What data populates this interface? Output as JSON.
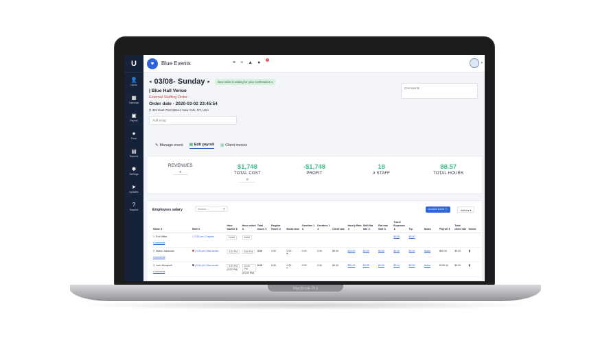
{
  "device": {
    "model_label": "MacBook Pro"
  },
  "sidebar": {
    "logo": "U",
    "items": [
      {
        "label": "Users",
        "icon": "user-icon",
        "glyph": "👤"
      },
      {
        "label": "Calendar",
        "icon": "calendar-icon",
        "glyph": "▦"
      },
      {
        "label": "Payroll",
        "icon": "payroll-icon",
        "glyph": "▣"
      },
      {
        "label": "Feed",
        "icon": "chat-icon",
        "glyph": "●"
      },
      {
        "label": "Reports",
        "icon": "report-icon",
        "glyph": "▤"
      },
      {
        "label": "Settings",
        "icon": "gear-icon",
        "glyph": "✱"
      },
      {
        "label": "Updates",
        "icon": "send-icon",
        "glyph": "➤"
      },
      {
        "label": "Support",
        "icon": "help-icon",
        "glyph": "?"
      }
    ]
  },
  "topbar": {
    "app_title": "Blue Events",
    "notification_count": "5"
  },
  "event": {
    "date_title": "03/08- Sunday",
    "status_pill": "New order is waiting for your confirmation",
    "venue": "| Blue Hall Venue",
    "order_type": "External Staffing Order -",
    "order_date": "Order date - 2020-03-02 23:45:54",
    "address": "321 East 73rd Street, New York, NY, USA",
    "tag_placeholder": "Add a tag",
    "comments_placeholder": "Comments"
  },
  "tabs": [
    {
      "label": "Manage event",
      "icon": "edit-icon"
    },
    {
      "label": "Edit payroll",
      "icon": "payroll-icon",
      "active": true
    },
    {
      "label": "Client invoice",
      "icon": "invoice-icon"
    }
  ],
  "stats": {
    "revenues_label": "REVENUES",
    "revenues_value": "0",
    "total_cost_value": "$1,748",
    "total_cost_label": "TOTAL COST",
    "total_cost_sub": "0",
    "profit_value": "-$1,748",
    "profit_label": "PROFIT",
    "staff_value": "18",
    "staff_label": "# STAFF",
    "hours_value": "88.57",
    "hours_label": "TOTAL HOURS",
    "accent_color": "#3bbf8a"
  },
  "salary": {
    "title": "Employees salary",
    "search_placeholder": "Search...",
    "archive_button": "Archive event",
    "actions_button": "Actions",
    "headers": [
      "Name ⇕",
      "Shift ⇕",
      "Hour started ⇕",
      "Hour ended ⇕",
      "Total hours ⇕",
      "Regular Hours ⇕",
      "Break time",
      "Overtime 1 ⇕",
      "Overtime 2 ⇕",
      "Client rate",
      "Hourly Rate ⇕",
      "Shift flat rate ⇕",
      "Flat rate limit ⇕",
      "Travel Expenses ⇕",
      "Tip",
      "Notes",
      "Payroll ⇕",
      "Total client rate",
      "Delete"
    ],
    "rows": [
      {
        "name": "1. Rub Mittal",
        "stars": "☆☆☆☆☆",
        "comments": "Comments",
        "shift": "| 3:30 pm | Captain",
        "start": "Insert",
        "end": "Insert",
        "total": "",
        "regular": "",
        "break": "",
        "ot1": "",
        "ot2": "",
        "client_rate": "",
        "hourly": "",
        "flat": "",
        "limit": "",
        "travel": "$0.00",
        "tip": "$0.00",
        "notes": "",
        "payroll": "",
        "total_client": ""
      },
      {
        "name": "2. Marko Jakanovic",
        "stars": "☆☆☆☆☆",
        "comments": "Comments",
        "shift": "| 3:30 pm | Bar-tender",
        "start": "3:30 PM",
        "end": "6:30 PM",
        "total": "3.00",
        "regular": "3.00",
        "break": "0.00",
        "ot1": "0.00",
        "ot2": "0.00",
        "client_rate": "$0.00",
        "hourly": "$23.00",
        "flat": "$0.00",
        "limit": "$0.00",
        "travel": "$0.00",
        "tip": "$0.00",
        "notes": "Notes",
        "payroll": "$69.00",
        "total_client": "$0.00"
      },
      {
        "name": "3. Josh Montycell",
        "stars": "☆☆☆☆☆",
        "comments": "Comments",
        "shift": "| 3:30 pm | Bar-tender",
        "start": "3:30 PM",
        "end": "10:00 PM",
        "start_sub": "(3:30 PM)",
        "end_sub": "(10:00 PM)",
        "total": "5.33",
        "regular": "6.00",
        "break": "0.00",
        "ot1": "0.00",
        "ot2": "0.00",
        "client_rate": "$0.00",
        "hourly": "$20.00",
        "flat": "$0.00",
        "limit": "$0.00",
        "travel": "$0.00",
        "tip": "$0.00",
        "notes": "Notes",
        "payroll": "$130.00",
        "total_client": "$0.00"
      }
    ]
  }
}
